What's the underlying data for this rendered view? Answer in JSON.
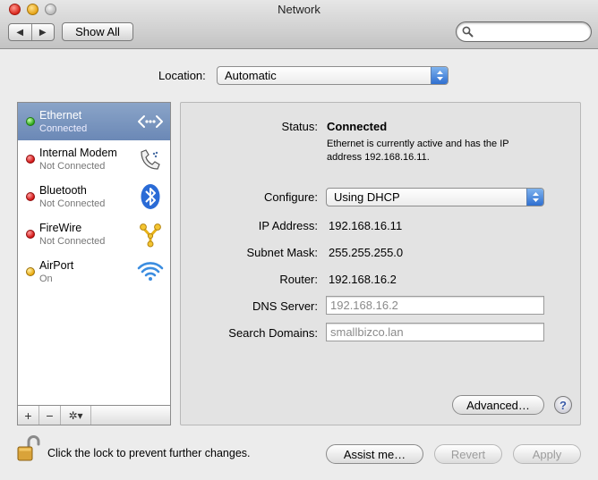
{
  "window": {
    "title": "Network"
  },
  "toolbar": {
    "back_icon": "back-arrow-icon",
    "forward_icon": "forward-arrow-icon",
    "show_all_label": "Show All",
    "search_value": ""
  },
  "location": {
    "label": "Location:",
    "value": "Automatic"
  },
  "services": [
    {
      "name": "Ethernet",
      "status": "Connected",
      "dot": "green",
      "icon": "ethernet-icon",
      "selected": true
    },
    {
      "name": "Internal Modem",
      "status": "Not Connected",
      "dot": "red",
      "icon": "phone-icon",
      "selected": false
    },
    {
      "name": "Bluetooth",
      "status": "Not Connected",
      "dot": "red",
      "icon": "bluetooth-icon",
      "selected": false
    },
    {
      "name": "FireWire",
      "status": "Not Connected",
      "dot": "red",
      "icon": "firewire-icon",
      "selected": false
    },
    {
      "name": "AirPort",
      "status": "On",
      "dot": "yellow",
      "icon": "wifi-icon",
      "selected": false
    }
  ],
  "sidebar_controls": {
    "add": "+",
    "remove": "−",
    "gear": "✲▾"
  },
  "detail": {
    "status_label": "Status:",
    "status_value": "Connected",
    "status_description": "Ethernet is currently active and has the IP address 192.168.16.11.",
    "configure_label": "Configure:",
    "configure_value": "Using DHCP",
    "ip_label": "IP Address:",
    "ip_value": "192.168.16.11",
    "subnet_label": "Subnet Mask:",
    "subnet_value": "255.255.255.0",
    "router_label": "Router:",
    "router_value": "192.168.16.2",
    "dns_label": "DNS Server:",
    "dns_value": "192.168.16.2",
    "search_domains_label": "Search Domains:",
    "search_domains_value": "smallbizco.lan",
    "advanced_label": "Advanced…",
    "help_label": "?"
  },
  "footer": {
    "lock_text": "Click the lock to prevent further changes.",
    "assist_label": "Assist me…",
    "revert_label": "Revert",
    "apply_label": "Apply"
  },
  "colors": {
    "selection": "#7a93bd",
    "connected": "#2ea81a",
    "not_connected": "#d11414",
    "on": "#e9a90d",
    "popup_arrows": "#2f6fd0"
  }
}
